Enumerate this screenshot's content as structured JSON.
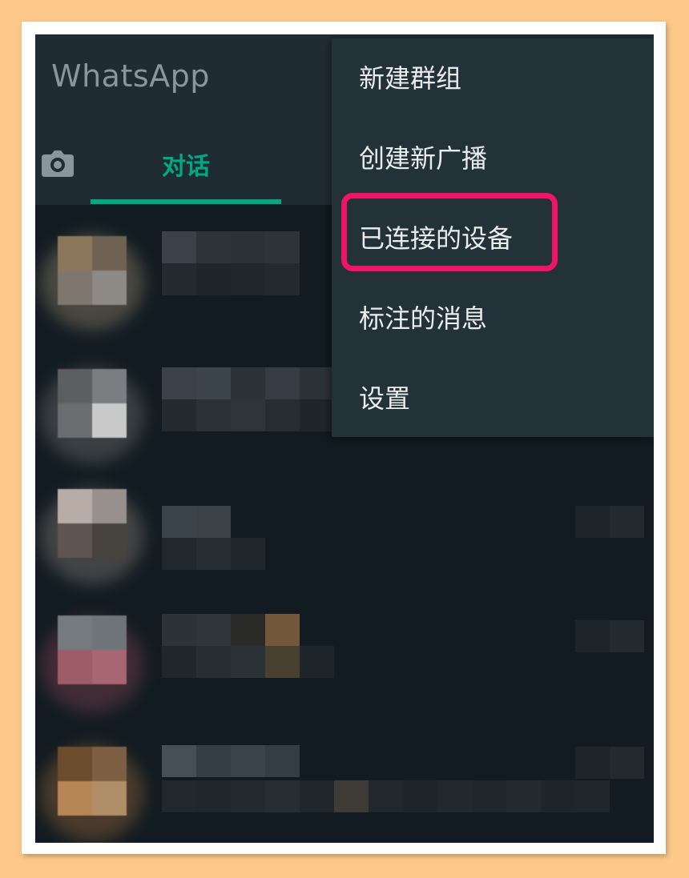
{
  "app": {
    "title": "WhatsApp"
  },
  "tabs": {
    "camera_icon": "camera-icon",
    "chats_label": "对话",
    "accent": "#00a884"
  },
  "menu": {
    "items": [
      {
        "label": "新建群组"
      },
      {
        "label": "创建新广播"
      },
      {
        "label": "已连接的设备",
        "highlighted": true
      },
      {
        "label": "标注的消息"
      },
      {
        "label": "设置"
      }
    ],
    "highlight_color": "#f01464"
  },
  "colors": {
    "page_bg": "#fdc98a",
    "screen_bg": "#111b21",
    "header_bg": "#202c33",
    "menu_bg": "#233138"
  },
  "chat_list": {
    "rows_visible": 5,
    "content": "pixelated"
  }
}
